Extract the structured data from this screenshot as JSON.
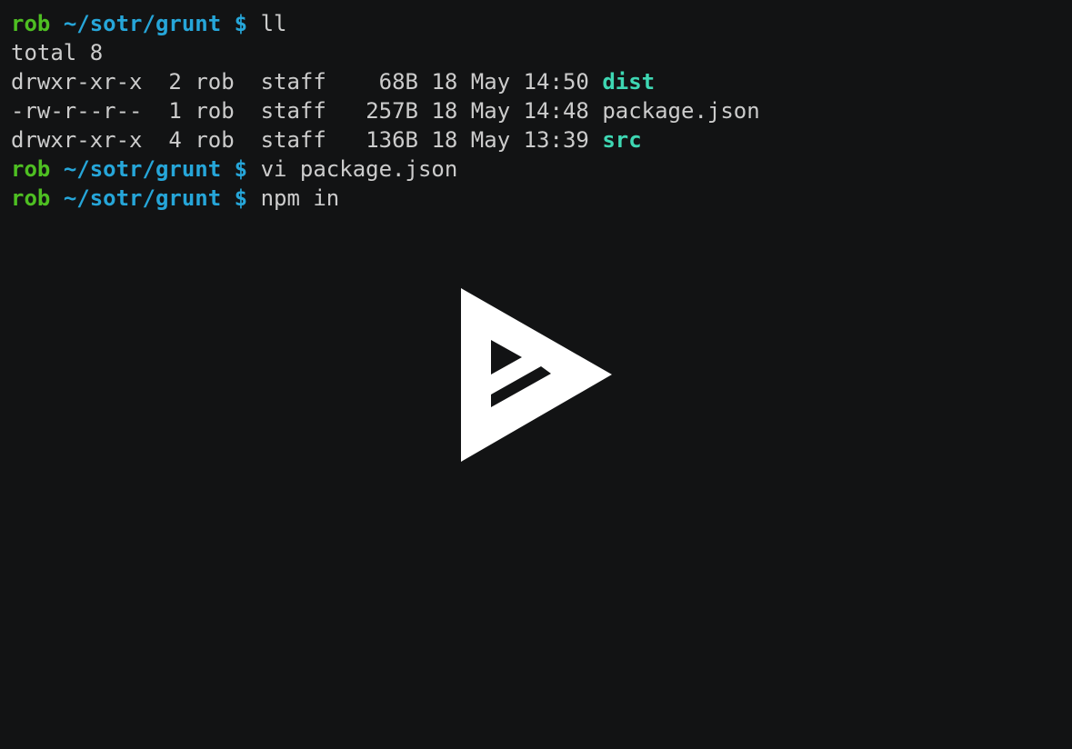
{
  "terminal": {
    "user": "rob",
    "path": "~/sotr/grunt",
    "prompt_symbol": "$",
    "commands": [
      "ll",
      "vi package.json",
      "npm in"
    ],
    "total_line": "total 8",
    "listing": [
      {
        "perms": "drwxr-xr-x",
        "links": "2",
        "owner": "rob",
        "group": "staff",
        "size": "68B",
        "day": "18",
        "month": "May",
        "time": "14:50",
        "name": "dist",
        "is_dir": true
      },
      {
        "perms": "-rw-r--r--",
        "links": "1",
        "owner": "rob",
        "group": "staff",
        "size": "257B",
        "day": "18",
        "month": "May",
        "time": "14:48",
        "name": "package.json",
        "is_dir": false
      },
      {
        "perms": "drwxr-xr-x",
        "links": "4",
        "owner": "rob",
        "group": "staff",
        "size": "136B",
        "day": "18",
        "month": "May",
        "time": "13:39",
        "name": "src",
        "is_dir": true
      }
    ]
  },
  "overlay": {
    "icon": "asciinema-play-icon"
  },
  "colors": {
    "background": "#121314",
    "user": "#4ebf22",
    "path": "#26a6d9",
    "directory": "#3ed7b3",
    "text": "#cccccc",
    "icon": "#ffffff"
  }
}
